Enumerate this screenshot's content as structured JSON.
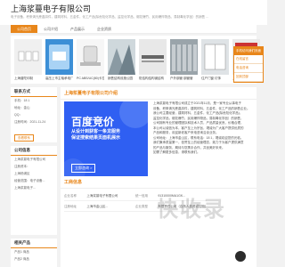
{
  "header": {
    "company": "上海浆蔓电子有限公司",
    "tagline": "电子设备，积条清光蔗晶扣件，建筑材料，五金件，化工产品(除危险化学品、监控化学品、烟花爆竹、民用爆炸物品、易制毒化学品）的销售 ..."
  },
  "nav": [
    "公司首页",
    "公司介绍",
    "产品展示",
    "企业资质"
  ],
  "gallery": [
    {
      "caption": "上海普陀印制"
    },
    {
      "caption": "高压上市主轴承电厂"
    },
    {
      "caption": "PC ABS/UC(80)卡拉曲面"
    },
    {
      "caption": "销售结构设施公园"
    },
    {
      "caption": "防结构结构钢结构"
    },
    {
      "caption": "户外钢管 钢管管"
    },
    {
      "caption": "住户门窗 灯饰"
    },
    {
      "caption": "上海盛世 产品门口"
    }
  ],
  "contact": {
    "heading": "联系方式",
    "fields": [
      "手机：18 1",
      "地址：金山",
      "QQ：",
      "注册时间：2021-11-24"
    ],
    "button": "查看联系"
  },
  "about": {
    "heading": "公司信息",
    "fields": [
      "上海浆蔓电子有限公司",
      "注册资本：",
      "上海杨浦区",
      "经营范围：电子设备...",
      "上海浆蔓电子..."
    ]
  },
  "product_side": {
    "heading": "相关产品",
    "items": [
      "产品1 商品",
      "产品2 商品"
    ]
  },
  "main": {
    "intro_heading": "上海浆蔓电子有限公司介绍",
    "banner": {
      "title": "百度竞价",
      "line1": "从设计到获客一条龙服务",
      "line2": "保证搜索结果页面机展示",
      "button": "立即咨询 >"
    },
    "intro_text": [
      "上海浆蔓电子有限公司成立于2021年11月，是一家专业从事电子",
      "设备，积条清光蔗晶扣件，建筑材料，五金件，化工产品的销售企业。",
      "我公司主要经营，建筑材料，五金件，化工产品(除危险化学品)，",
      "监控化学品，烟花爆竹，民用爆炸物品，易制毒化学品）的销售，",
      "公司拥有专业的管理团队和技术人员，产品质量优良，价格合理，",
      "本公司以诚信为本，客户至上为宗旨，竭诚为广大客户提供优质的",
      "产品和服务，欢迎新老客户来电咨询洽谈业务。",
      "公司地址：上海市金山区，联系电话：18 1，竭诚欢迎您的光临。",
      "我们秉承质量第一，信誉至上的经营理念，致力于为客户提供满意",
      "的产品与服务，期待与您携手合作，共创美好未来。",
      "如需了解更多信息，请联系我们。"
    ],
    "biz_heading": "工商信息",
    "biz_rows": [
      {
        "k": "企业名称",
        "v": "上海浆蔓电子有限公司"
      },
      {
        "k": "统一信用",
        "v": "91310000MA1GK..."
      },
      {
        "k": "注册地址",
        "v": "上海市金山区..."
      },
      {
        "k": "企业类型",
        "v": "有限责任公司（自然人投资或控股）"
      }
    ]
  },
  "float_panel": {
    "head": "手机访问我们页面",
    "rows": [
      "在线留言",
      "电话咨询",
      "回到顶部"
    ]
  },
  "watermark": "快收录"
}
